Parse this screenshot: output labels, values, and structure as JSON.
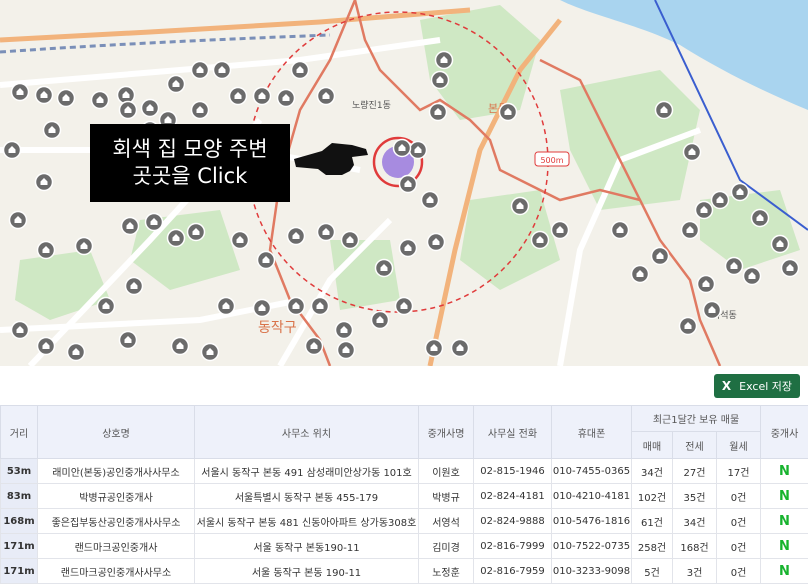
{
  "map": {
    "labels": {
      "district": "동작구",
      "distance": "500m",
      "noryangjin": "노량진1동",
      "heukseok": "흑석동",
      "bonbon": "본동"
    },
    "callout": {
      "line1": "회색 집 모양 주변",
      "line2": "곳곳을 Click"
    },
    "colors": {
      "water": "#a9d4ef",
      "park": "#cfe8c4",
      "road_main": "#f2b37c",
      "boundary": "#e07a62",
      "circle": "#e03b3b",
      "marker": "#6b6b6b",
      "selected": "#a78be0"
    }
  },
  "toolbar": {
    "excel_label": "Excel 저장"
  },
  "table": {
    "headers": {
      "distance": "거리",
      "name": "상호명",
      "address": "사무소 위치",
      "agent": "중개사명",
      "phone": "사무실 전화",
      "mobile": "휴대폰",
      "recent": "최근1달간 보유 매물",
      "sale": "매매",
      "jeonse": "전세",
      "monthly": "월세",
      "broker": "중개사"
    },
    "rows": [
      {
        "dist": "53m",
        "name": "래미안(본동)공인중개사사무소",
        "addr": "서울시 동작구 본동 491 삼성래미안상가동 101호",
        "agent": "이원호",
        "phone": "02-815-1946",
        "mobile": "010-7455-0365",
        "sale": "34건",
        "jeonse": "27건",
        "monthly": "17건",
        "badge": "N"
      },
      {
        "dist": "83m",
        "name": "박병규공인중개사",
        "addr": "서울특별시 동작구 본동 455-179",
        "agent": "박병규",
        "phone": "02-824-4181",
        "mobile": "010-4210-4181",
        "sale": "102건",
        "jeonse": "35건",
        "monthly": "0건",
        "badge": "N"
      },
      {
        "dist": "168m",
        "name": "좋은집부동산공인중개사사무소",
        "addr": "서울시 동작구 본동 481 신동아아파트 상가동308호",
        "agent": "서영석",
        "phone": "02-824-9888",
        "mobile": "010-5476-1816",
        "sale": "61건",
        "jeonse": "34건",
        "monthly": "0건",
        "badge": "N"
      },
      {
        "dist": "171m",
        "name": "랜드마크공인중개사",
        "addr": "서울 동작구 본동190-11",
        "agent": "김미경",
        "phone": "02-816-7999",
        "mobile": "010-7522-0735",
        "sale": "258건",
        "jeonse": "168건",
        "monthly": "0건",
        "badge": "N"
      },
      {
        "dist": "171m",
        "name": "랜드마크공인중개사사무소",
        "addr": "서울 동작구 본동 190-11",
        "agent": "노정훈",
        "phone": "02-816-7959",
        "mobile": "010-3233-9098",
        "sale": "5건",
        "jeonse": "3건",
        "monthly": "0건",
        "badge": "N"
      }
    ]
  }
}
